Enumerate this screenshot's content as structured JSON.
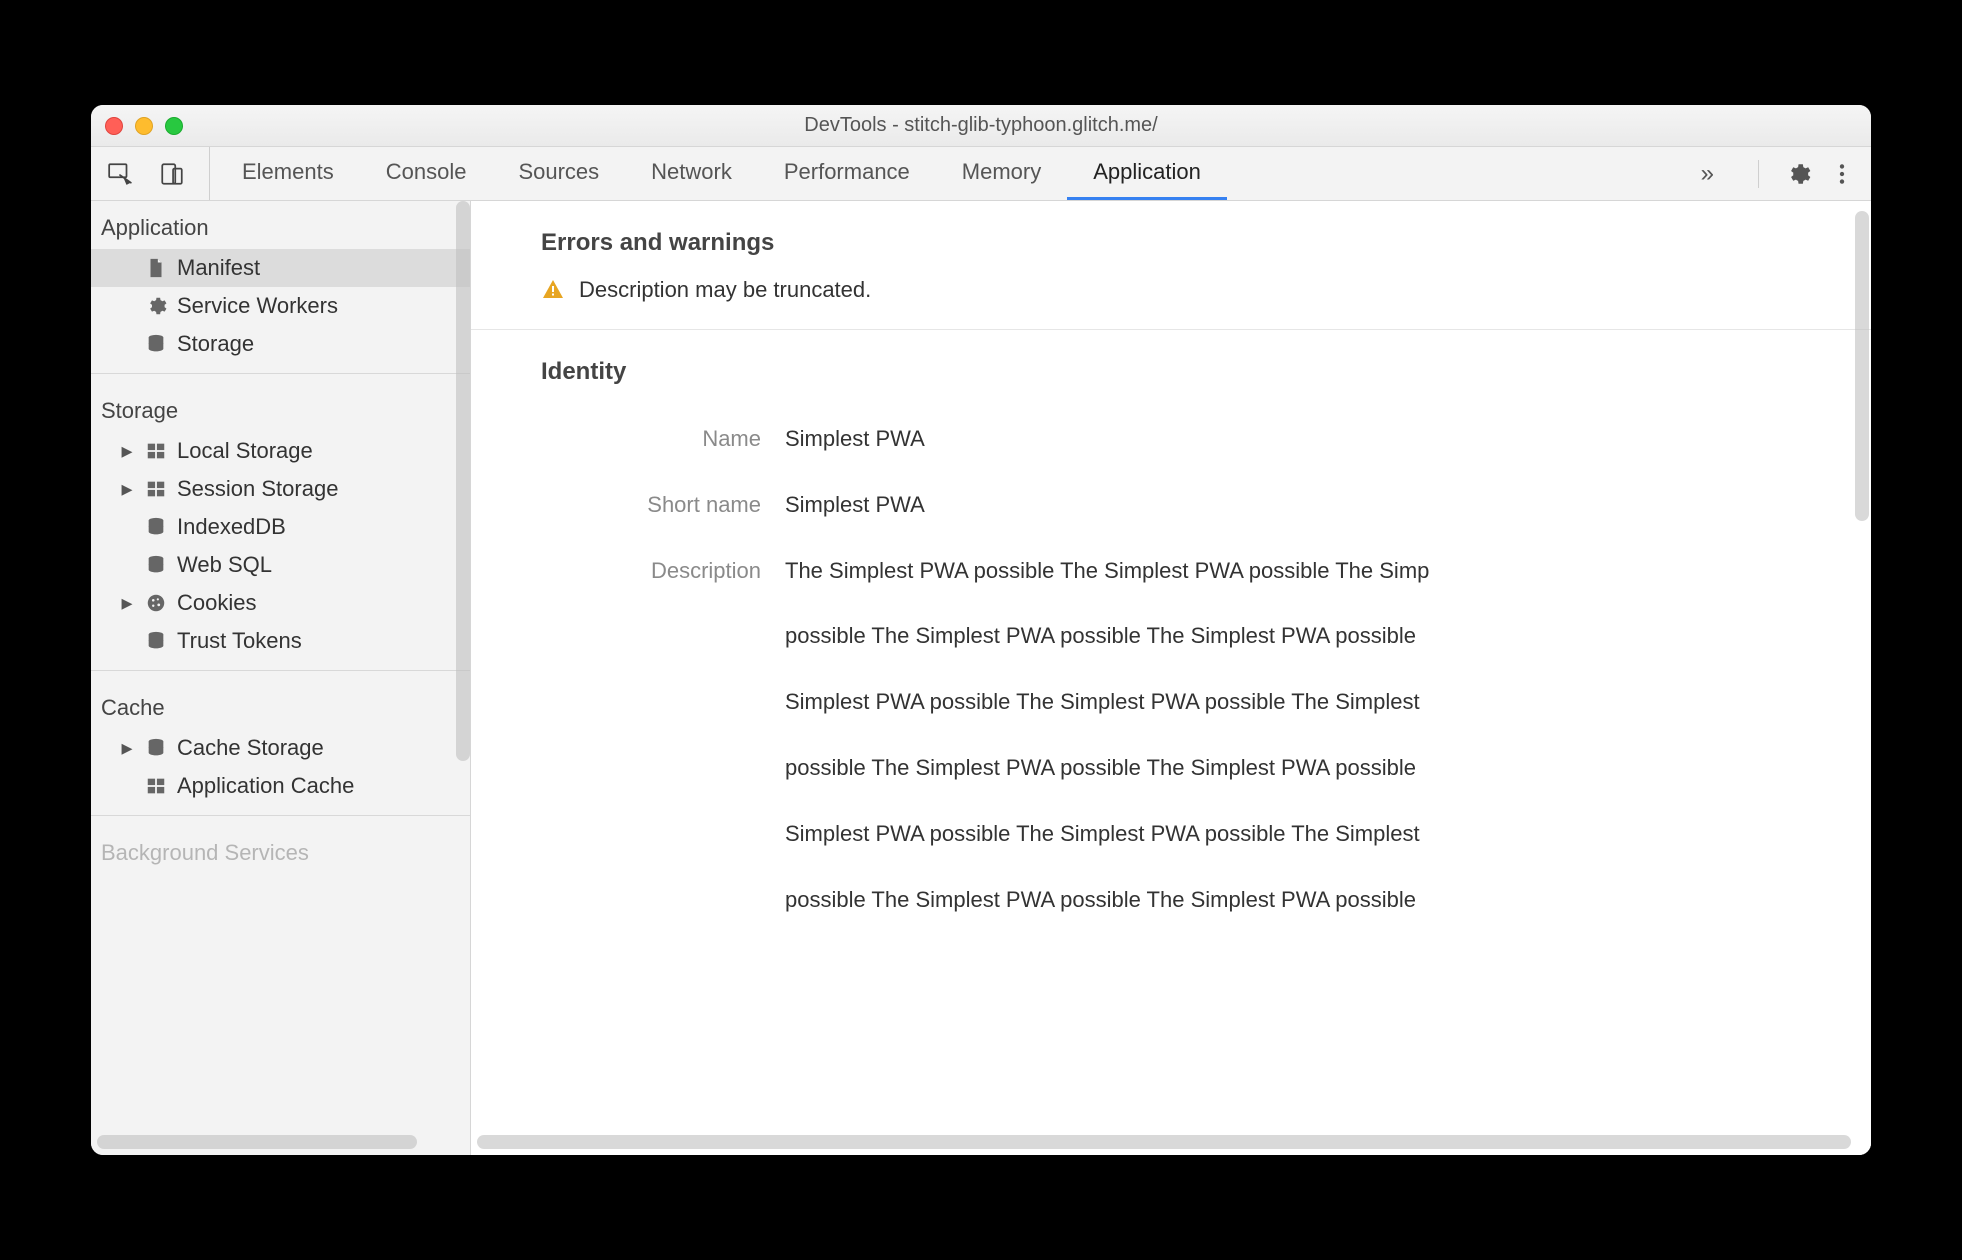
{
  "window": {
    "title": "DevTools - stitch-glib-typhoon.glitch.me/"
  },
  "toolbar": {
    "tabs": [
      {
        "label": "Elements",
        "active": false
      },
      {
        "label": "Console",
        "active": false
      },
      {
        "label": "Sources",
        "active": false
      },
      {
        "label": "Network",
        "active": false
      },
      {
        "label": "Performance",
        "active": false
      },
      {
        "label": "Memory",
        "active": false
      },
      {
        "label": "Application",
        "active": true
      }
    ],
    "overflow_icon": "»"
  },
  "sidebar": {
    "groups": [
      {
        "title": "Application",
        "items": [
          {
            "label": "Manifest",
            "icon": "file-icon",
            "selected": true,
            "caret": false
          },
          {
            "label": "Service Workers",
            "icon": "gear-icon",
            "selected": false,
            "caret": false
          },
          {
            "label": "Storage",
            "icon": "db-icon",
            "selected": false,
            "caret": false
          }
        ]
      },
      {
        "title": "Storage",
        "items": [
          {
            "label": "Local Storage",
            "icon": "grid-icon",
            "selected": false,
            "caret": true
          },
          {
            "label": "Session Storage",
            "icon": "grid-icon",
            "selected": false,
            "caret": true
          },
          {
            "label": "IndexedDB",
            "icon": "db-icon",
            "selected": false,
            "caret": false
          },
          {
            "label": "Web SQL",
            "icon": "db-icon",
            "selected": false,
            "caret": false
          },
          {
            "label": "Cookies",
            "icon": "cookie-icon",
            "selected": false,
            "caret": true
          },
          {
            "label": "Trust Tokens",
            "icon": "db-icon",
            "selected": false,
            "caret": false
          }
        ]
      },
      {
        "title": "Cache",
        "items": [
          {
            "label": "Cache Storage",
            "icon": "db-icon",
            "selected": false,
            "caret": true
          },
          {
            "label": "Application Cache",
            "icon": "grid-icon",
            "selected": false,
            "caret": false
          }
        ]
      },
      {
        "title": "Background Services",
        "items": []
      }
    ]
  },
  "content": {
    "errors": {
      "heading": "Errors and warnings",
      "items": [
        {
          "type": "warning",
          "text": "Description may be truncated."
        }
      ]
    },
    "identity": {
      "heading": "Identity",
      "name_label": "Name",
      "name_value": "Simplest PWA",
      "short_name_label": "Short name",
      "short_name_value": "Simplest PWA",
      "description_label": "Description",
      "description_lines": [
        "The Simplest PWA possible The Simplest PWA possible The Simp",
        "possible The Simplest PWA possible The Simplest PWA possible ",
        "Simplest PWA possible The Simplest PWA possible The Simplest",
        "possible The Simplest PWA possible The Simplest PWA possible ",
        "Simplest PWA possible The Simplest PWA possible The Simplest",
        "possible The Simplest PWA possible The Simplest PWA possible"
      ]
    }
  },
  "colors": {
    "accent": "#3681f1",
    "warning": "#e7a522"
  }
}
